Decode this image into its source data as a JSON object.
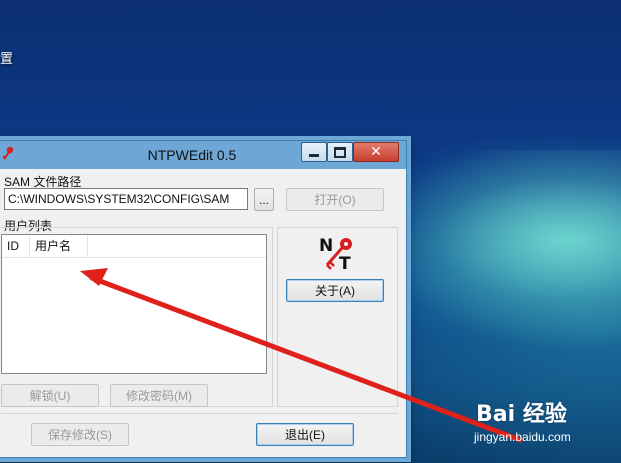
{
  "desktop": {
    "label": "置"
  },
  "window": {
    "title": "NTPWEdit 0.5",
    "controls": {
      "minimize_icon": "minimize-icon",
      "maximize_icon": "maximize-icon",
      "close_icon": "close-icon"
    }
  },
  "sam": {
    "label": "SAM 文件路径",
    "path_value": "C:\\WINDOWS\\SYSTEM32\\CONFIG\\SAM",
    "browse_label": "...",
    "open_label": "打开(O)"
  },
  "users": {
    "label": "用户列表",
    "columns": [
      "ID",
      "用户名"
    ],
    "rows": []
  },
  "buttons": {
    "about": "关于(A)",
    "unlock": "解锁(U)",
    "change_password": "修改密码(M)",
    "save": "保存修改(S)",
    "exit": "退出(E)"
  },
  "logo": {
    "icon": "ntpwedit-key-logo-icon"
  },
  "watermark": {
    "brand": "Bai 经验",
    "url": "jingyan.baidu.com"
  },
  "colors": {
    "titlebar": "#6ea6d6",
    "window_border": "#3c7fb1",
    "arrow": "#e0201a",
    "desktop_blue": "#0d3a86"
  }
}
